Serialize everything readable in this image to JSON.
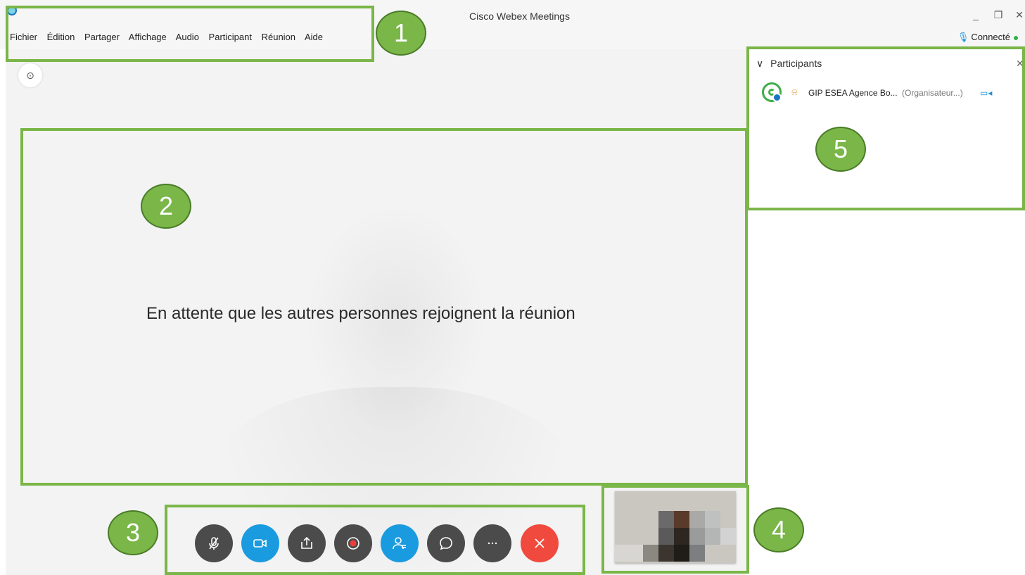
{
  "window": {
    "title": "Cisco Webex Meetings",
    "minimize_glyph": "_",
    "maximize_glyph": "❐",
    "close_glyph": "✕"
  },
  "menu": [
    "Fichier",
    "Édition",
    "Partager",
    "Affichage",
    "Audio",
    "Participant",
    "Réunion",
    "Aide"
  ],
  "status": {
    "connected_label": "Connecté",
    "dot_color": "#2fb24c"
  },
  "stage": {
    "info_glyph": "⊙",
    "waiting_message": "En attente que les autres personnes rejoignent la réunion"
  },
  "controls": [
    {
      "name": "mute-button",
      "icon": "microphone-muted-icon",
      "color": "#4b4b4b"
    },
    {
      "name": "video-button",
      "icon": "video-camera-icon",
      "color": "#1a9be0"
    },
    {
      "name": "share-button",
      "icon": "share-upload-icon",
      "color": "#4b4b4b"
    },
    {
      "name": "record-button",
      "icon": "record-icon",
      "color": "#4b4b4b"
    },
    {
      "name": "participants-button",
      "icon": "participants-icon",
      "color": "#1a9be0"
    },
    {
      "name": "chat-button",
      "icon": "chat-bubble-icon",
      "color": "#4b4b4b"
    },
    {
      "name": "more-options-button",
      "icon": "more-icon",
      "color": "#4b4b4b"
    },
    {
      "name": "leave-meeting-button",
      "icon": "close-icon",
      "color": "#f04a3e"
    }
  ],
  "participants_panel": {
    "header_chevron": "∨",
    "title": "Participants",
    "close_glyph": "✕",
    "participants": [
      {
        "name": "GIP ESEA Agence Bo...",
        "role": "(Organisateur...)",
        "host_glyph": "⍾",
        "video_glyph": "▭◂"
      }
    ]
  },
  "annotations": {
    "border_color": "#7ab648",
    "badges": [
      "1",
      "2",
      "3",
      "4",
      "5"
    ]
  }
}
